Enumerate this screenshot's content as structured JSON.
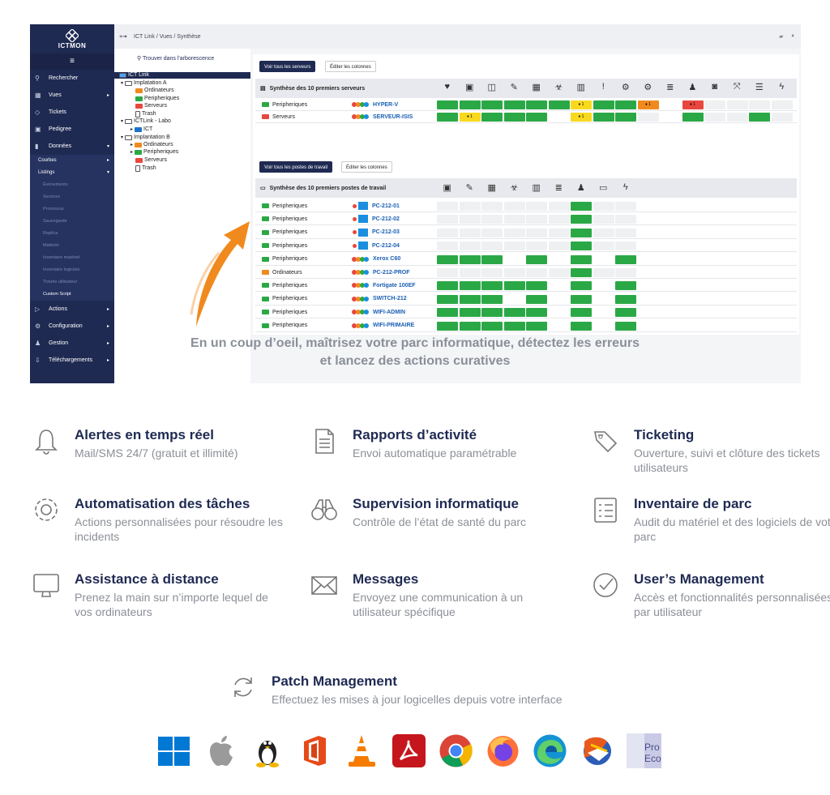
{
  "app": {
    "brand": "ICTMON",
    "breadcrumb": "ICT Link  /  Vues  /  Synthèse"
  },
  "sidebar": {
    "items": [
      {
        "label": "Rechercher",
        "icon": "search-icon"
      },
      {
        "label": "Vues",
        "icon": "grid-icon"
      },
      {
        "label": "Tickets",
        "icon": "tag-icon"
      },
      {
        "label": "Pedigree",
        "icon": "image-icon"
      },
      {
        "label": "Données",
        "icon": "bar-chart-icon"
      }
    ],
    "sub": [
      {
        "label": "Courbes"
      },
      {
        "label": "Listings"
      }
    ],
    "listings": [
      "Événements",
      "Services",
      "Processus",
      "Sauvegarde",
      "Replica",
      "Matériel",
      "Inventaire matériel",
      "Inventaire logiciels",
      "Tickets utilisateur"
    ],
    "custom": "Custom Script",
    "bottom": [
      {
        "label": "Actions"
      },
      {
        "label": "Configuration"
      },
      {
        "label": "Gestion"
      },
      {
        "label": "Téléchargements"
      }
    ]
  },
  "tree": {
    "search": "Trouver dans l'arborescence",
    "nodes": [
      "ICT Link",
      "Implatation A",
      "Ordinateurs",
      "Peripheriques",
      "Serveurs",
      "Trash",
      "ICTLink - Labo",
      "ICT",
      "Implantation B",
      "Ordinateurs",
      "Peripheriques",
      "Serveurs",
      "Trash"
    ]
  },
  "servers": {
    "btn_all": "Voir tous les serveurs",
    "btn_cols": "Éditer les colonnes",
    "title": "Synthèse des 10 premiers serveurs",
    "rows": [
      {
        "cat": "Peripheriques",
        "name": "HYPER-V",
        "folder": "#2ba846",
        "cells": [
          "g",
          "g",
          "g",
          "g",
          "g",
          "g",
          "y1",
          "g",
          "g",
          "o1",
          "n",
          "r1",
          "e",
          "e",
          "e",
          "e"
        ]
      },
      {
        "cat": "Serveurs",
        "name": "SERVEUR-ISIS",
        "folder": "#e8473f",
        "cells": [
          "g",
          "y1",
          "g",
          "g",
          "g",
          "n",
          "y1",
          "g",
          "g",
          "e",
          "n",
          "g",
          "e",
          "e",
          "g",
          "e"
        ]
      }
    ]
  },
  "workstations": {
    "btn_all": "Voir tous les postes de travail",
    "btn_cols": "Éditer les colonnes",
    "title": "Synthèse des 10 premiers postes de travail",
    "rows": [
      {
        "cat": "Peripheriques",
        "name": "PC-212-01",
        "os": "windows",
        "cells": [
          "e",
          "e",
          "e",
          "e",
          "e",
          "e",
          "g",
          "e",
          "e"
        ]
      },
      {
        "cat": "Peripheriques",
        "name": "PC-212-02",
        "os": "windows",
        "cells": [
          "e",
          "e",
          "e",
          "e",
          "e",
          "e",
          "g",
          "e",
          "e"
        ]
      },
      {
        "cat": "Peripheriques",
        "name": "PC-212-03",
        "os": "windows",
        "cells": [
          "e",
          "e",
          "e",
          "e",
          "e",
          "e",
          "g",
          "e",
          "e"
        ]
      },
      {
        "cat": "Peripheriques",
        "name": "PC-212-04",
        "os": "windows",
        "cells": [
          "e",
          "e",
          "e",
          "e",
          "e",
          "e",
          "g",
          "e",
          "e"
        ]
      },
      {
        "cat": "Peripheriques",
        "name": "Xerox C60",
        "os": "dots",
        "cells": [
          "g",
          "g",
          "g",
          "n",
          "g",
          "n",
          "g",
          "n",
          "g"
        ]
      },
      {
        "cat": "Ordinateurs",
        "name": "PC-212-PROF",
        "os": "dots",
        "cells": [
          "e",
          "e",
          "e",
          "e",
          "e",
          "e",
          "g",
          "e",
          "e"
        ]
      },
      {
        "cat": "Peripheriques",
        "name": "Fortigate 100EF",
        "os": "dots",
        "cells": [
          "g",
          "g",
          "g",
          "g",
          "g",
          "n",
          "g",
          "n",
          "g"
        ]
      },
      {
        "cat": "Peripheriques",
        "name": "SWITCH-212",
        "os": "dots",
        "cells": [
          "g",
          "g",
          "g",
          "n",
          "g",
          "n",
          "g",
          "n",
          "g"
        ]
      },
      {
        "cat": "Peripheriques",
        "name": "WIFI-ADMIN",
        "os": "dots",
        "cells": [
          "g",
          "g",
          "g",
          "g",
          "g",
          "n",
          "g",
          "n",
          "g"
        ]
      },
      {
        "cat": "Peripheriques",
        "name": "WIFI-PRIMAIRE",
        "os": "dots",
        "cells": [
          "g",
          "g",
          "g",
          "g",
          "g",
          "n",
          "g",
          "n",
          "g"
        ]
      }
    ]
  },
  "tagline": [
    "En un coup d’oeil, maîtrisez votre parc informatique, détectez les erreurs",
    "et lancez des actions curatives"
  ],
  "features": [
    {
      "title": "Alertes en temps réel",
      "desc": "Mail/SMS 24/7 (gratuit et illimité)",
      "icon": "bell-icon"
    },
    {
      "title": "Rapports d’activité",
      "desc": "Envoi automatique paramétrable",
      "icon": "document-icon"
    },
    {
      "title": "Ticketing",
      "desc": "Ouverture, suivi et clôture des tickets utilisateurs",
      "icon": "tags-icon"
    },
    {
      "title": "Automatisation des tâches",
      "desc": "Actions personnalisées pour résoudre les incidents",
      "icon": "gear-icon"
    },
    {
      "title": "Supervision informatique",
      "desc": "Contrôle de l’état de santé du parc",
      "icon": "binoculars-icon"
    },
    {
      "title": "Inventaire de parc",
      "desc": "Audit du matériel et des logiciels de votre parc",
      "icon": "checklist-icon"
    },
    {
      "title": "Assistance à distance",
      "desc": "Prenez la main sur n’importe lequel de vos ordinateurs",
      "icon": "monitor-icon"
    },
    {
      "title": "Messages",
      "desc": "Envoyez une communication à un utilisateur spécifique",
      "icon": "envelope-icon"
    },
    {
      "title": "User’s Management",
      "desc": "Accès et fonctionnalités personnalisées par utilisateur",
      "icon": "check-circle-icon"
    },
    {
      "title": "Patch Management",
      "desc": "Effectuez les mises à jour logicelles depuis votre interface",
      "icon": "refresh-icon"
    }
  ],
  "logos": [
    "windows-logo",
    "apple-logo",
    "linux-logo",
    "office-logo",
    "vlc-logo",
    "acrobat-logo",
    "chrome-logo",
    "firefox-logo",
    "edge-logo",
    "thunderbird-logo",
    "proeco-logo"
  ],
  "proeco_text": "Pro Eco",
  "colors": {
    "navy": "#1f2a52",
    "green": "#2ba846",
    "yellow": "#f8d91e",
    "orange": "#f08a1e",
    "red": "#e8473f",
    "accent_arrow": "#f08a1e"
  }
}
